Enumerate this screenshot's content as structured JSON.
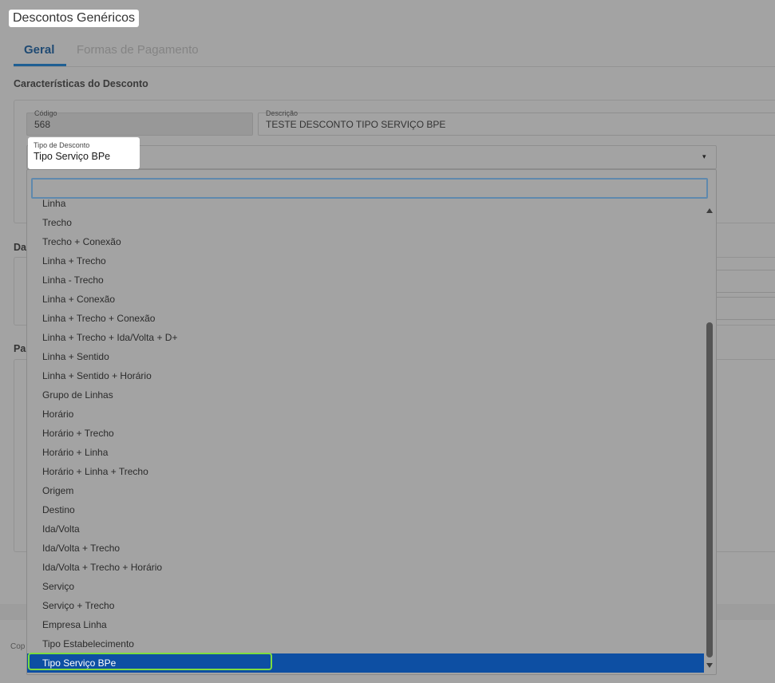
{
  "page": {
    "title": "Descontos Genéricos",
    "tabs": [
      {
        "label": "Geral",
        "active": true
      },
      {
        "label": "Formas de Pagamento",
        "active": false
      }
    ],
    "section_title": "Características do Desconto",
    "side_fragments": [
      "Da",
      "Pa"
    ],
    "footer_fragment": "Cop"
  },
  "form": {
    "codigo": {
      "label": "Código",
      "value": "568"
    },
    "descricao": {
      "label": "Descrição",
      "value": "TESTE DESCONTO TIPO SERVIÇO BPE"
    },
    "tipo_desconto": {
      "label": "Tipo de Desconto",
      "value": "Tipo Serviço BPe",
      "caret": "▾"
    }
  },
  "dropdown": {
    "search_value": "",
    "options": [
      {
        "label": "Linha",
        "selected": false
      },
      {
        "label": "Trecho",
        "selected": false
      },
      {
        "label": "Trecho + Conexão",
        "selected": false
      },
      {
        "label": "Linha + Trecho",
        "selected": false
      },
      {
        "label": "Linha - Trecho",
        "selected": false
      },
      {
        "label": "Linha + Conexão",
        "selected": false
      },
      {
        "label": "Linha + Trecho + Conexão",
        "selected": false
      },
      {
        "label": "Linha + Trecho + Ida/Volta + D+",
        "selected": false
      },
      {
        "label": "Linha + Sentido",
        "selected": false
      },
      {
        "label": "Linha + Sentido + Horário",
        "selected": false
      },
      {
        "label": "Grupo de Linhas",
        "selected": false
      },
      {
        "label": "Horário",
        "selected": false
      },
      {
        "label": "Horário + Trecho",
        "selected": false
      },
      {
        "label": "Horário + Linha",
        "selected": false
      },
      {
        "label": "Horário + Linha + Trecho",
        "selected": false
      },
      {
        "label": "Origem",
        "selected": false
      },
      {
        "label": "Destino",
        "selected": false
      },
      {
        "label": "Ida/Volta",
        "selected": false
      },
      {
        "label": "Ida/Volta + Trecho",
        "selected": false
      },
      {
        "label": "Ida/Volta + Trecho + Horário",
        "selected": false
      },
      {
        "label": "Serviço",
        "selected": false
      },
      {
        "label": "Serviço + Trecho",
        "selected": false
      },
      {
        "label": "Empresa Linha",
        "selected": false
      },
      {
        "label": "Tipo Estabelecimento",
        "selected": false
      },
      {
        "label": "Tipo Serviço BPe",
        "selected": true
      }
    ]
  },
  "colors": {
    "accent": "#1f5f93",
    "selected_option_bg": "#0d4fa3",
    "highlight_ring": "#7ddc3f",
    "overlay_gray": "#a3a3a3"
  },
  "icons": {
    "select_caret": "chevron-down-icon",
    "scroll_up": "scroll-up-arrow-icon",
    "scroll_down": "scroll-down-arrow-icon"
  }
}
